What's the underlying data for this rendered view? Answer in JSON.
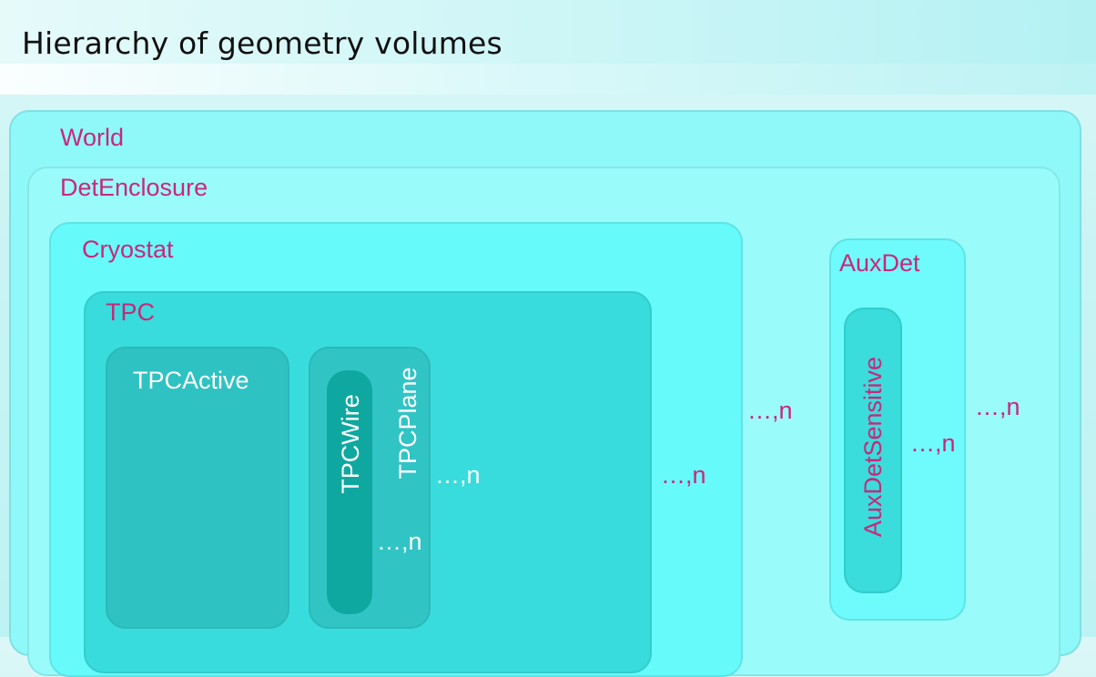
{
  "title": "Hierarchy of geometry volumes",
  "colors": {
    "magenta": "#c8287a",
    "world": "#8ff9fa",
    "det_enclosure": "#9afbfb",
    "cryostat": "#67fafb",
    "tpc": "#38dcdc",
    "tpc_active": "#2fc2c3",
    "tpc_plane": "#31c4c5",
    "tpc_wire": "#0ea8a0",
    "aux_det": "#6ffbfb",
    "aux_det_sensitive": "#3adcdc"
  },
  "volumes": {
    "world": "World",
    "det_enclosure": "DetEnclosure",
    "cryostat": "Cryostat",
    "tpc": "TPC",
    "tpc_active": "TPCActive",
    "tpc_plane": "TPCPlane",
    "tpc_wire": "TPCWire",
    "aux_det": "AuxDet",
    "aux_det_sensitive": "AuxDetSensitive"
  },
  "multiplicity": {
    "tpc_plane": "…,n",
    "tpc_wire": "…,n",
    "tpc": "…,n",
    "cryostat": "…,n",
    "aux_det_sensitive": "…,n",
    "aux_det": "…,n"
  }
}
